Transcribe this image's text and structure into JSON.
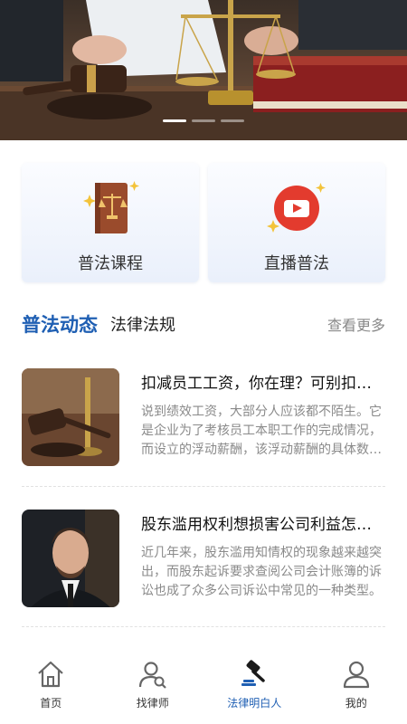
{
  "banner": {
    "slides": 3,
    "active_index": 0
  },
  "features": [
    {
      "label": "普法课程",
      "icon": "law-book-icon"
    },
    {
      "label": "直播普法",
      "icon": "play-video-icon"
    }
  ],
  "section": {
    "tab_active": "普法动态",
    "tab_other": "法律法规",
    "more": "查看更多"
  },
  "articles": [
    {
      "title": "扣减员工工资，你在理？可别扣错了！",
      "desc": "说到绩效工资，大部分人应该都不陌生。它是企业为了考核员工本职工作的完成情况，而设立的浮动薪酬，该浮动薪酬的具体数额由考核结果决定。"
    },
    {
      "title": "股东滥用权利想损害公司利益怎么办",
      "desc": "近几年来，股东滥用知情权的现象越来越突出，而股东起诉要求查阅公司会计账簿的诉讼也成了众多公司诉讼中常见的一种类型。"
    }
  ],
  "nav": [
    {
      "label": "首页",
      "icon": "home-icon"
    },
    {
      "label": "找律师",
      "icon": "find-lawyer-icon"
    },
    {
      "label": "法律明白人",
      "icon": "gavel-icon",
      "active": true
    },
    {
      "label": "我的",
      "icon": "profile-icon"
    }
  ],
  "colors": {
    "accent": "#1f5fb3",
    "video_red": "#e33b2e",
    "book_brown": "#9a4b2c"
  }
}
